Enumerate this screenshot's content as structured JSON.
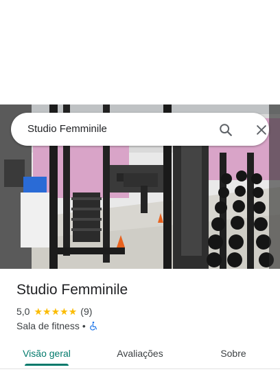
{
  "search": {
    "query": "Studio Femminile",
    "icons": [
      "search-icon",
      "close-icon"
    ]
  },
  "hero_photo": {
    "description_icon": "gym-photo",
    "colors": {
      "floor": "#d8d6d0",
      "wall_pink": "#d9a4c8",
      "frame": "#1c1c1c",
      "accent_orange": "#e8621e",
      "accent_blue": "#2a6bd6"
    }
  },
  "place": {
    "name": "Studio Femminile",
    "rating": "5,0",
    "stars": 5,
    "review_count": "(9)",
    "category": "Sala de fitness",
    "separator": "•",
    "accessibility_icon": "wheelchair-icon"
  },
  "tabs": [
    {
      "label": "Visão geral",
      "active": true
    },
    {
      "label": "Avaliações",
      "active": false
    },
    {
      "label": "Sobre",
      "active": false
    }
  ],
  "colors": {
    "accent": "#00796b",
    "star": "#fbbc04",
    "text_primary": "#202124",
    "text_secondary": "#3c4043",
    "accessibility_blue": "#1a73e8"
  }
}
